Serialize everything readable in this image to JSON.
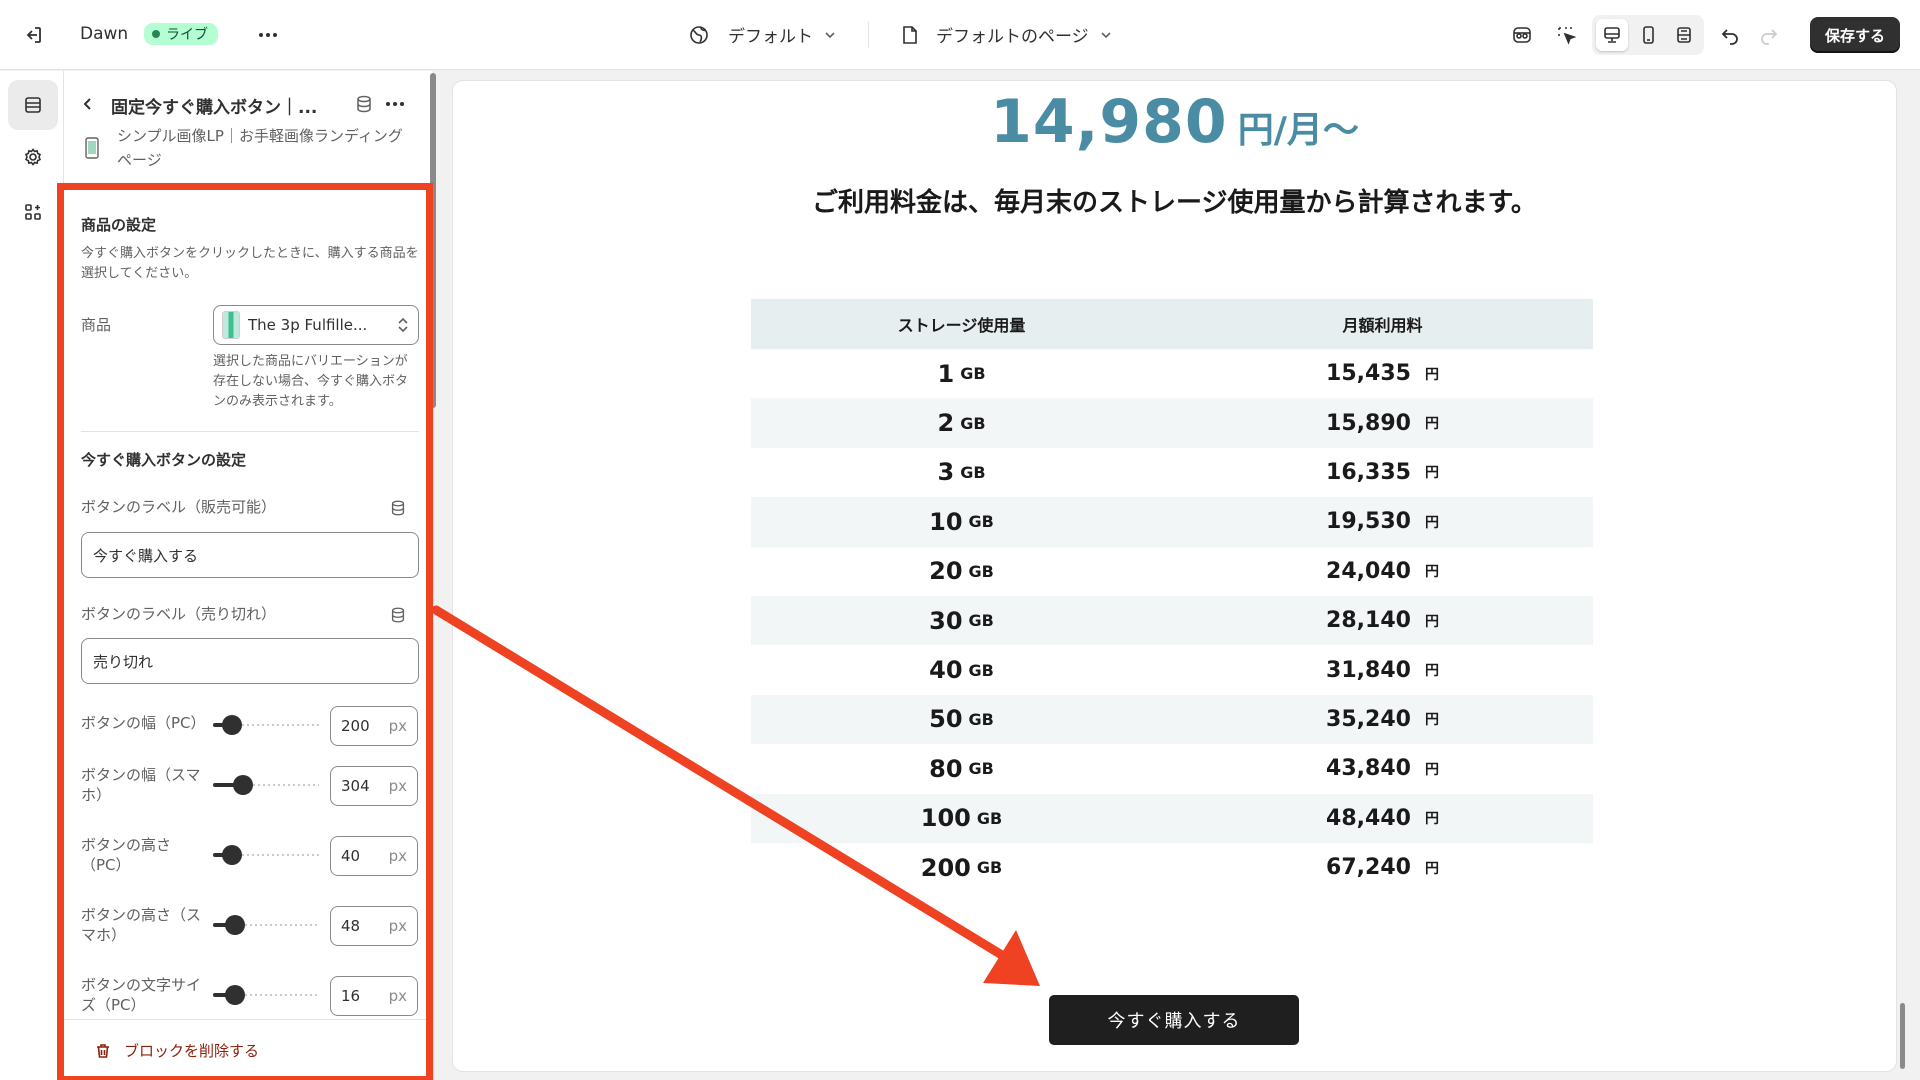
{
  "topbar": {
    "theme_name": "Dawn",
    "live_badge": "ライブ",
    "template_dropdown": "デフォルト",
    "page_dropdown": "デフォルトのページ",
    "save_label": "保存する"
  },
  "panel": {
    "block_title": "固定今すぐ購入ボタン｜...",
    "page_subtitle": "シンプル画像LP｜お手軽画像ランディングページ",
    "product_settings": {
      "title": "商品の設定",
      "help": "今すぐ購入ボタンをクリックしたときに、購入する商品を選択してください。",
      "product_label": "商品",
      "product_value": "The 3p Fulfille...",
      "variation_note": "選択した商品にバリエーションが存在しない場合、今すぐ購入ボタンのみ表示されます。"
    },
    "button_settings": {
      "title": "今すぐ購入ボタンの設定",
      "label_available": "ボタンのラベル（販売可能）",
      "value_available": "今すぐ購入する",
      "label_soldout": "ボタンのラベル（売り切れ）",
      "value_soldout": "売り切れ"
    },
    "sliders": [
      {
        "label": "ボタンの幅（PC）",
        "value": "200",
        "unit": "px",
        "fraction": 0.18
      },
      {
        "label": "ボタンの幅（スマホ）",
        "value": "304",
        "unit": "px",
        "fraction": 0.28
      },
      {
        "label": "ボタンの高さ（PC）",
        "value": "40",
        "unit": "px",
        "fraction": 0.18
      },
      {
        "label": "ボタンの高さ（スマホ）",
        "value": "48",
        "unit": "px",
        "fraction": 0.21
      },
      {
        "label": "ボタンの文字サイズ（PC）",
        "value": "16",
        "unit": "px",
        "fraction": 0.21
      }
    ],
    "delete_label": "ブロックを削除する"
  },
  "preview": {
    "price_number": "14,980",
    "price_unit": "円/月〜",
    "pricing_note": "ご利用料金は、毎月末のストレージ使用量から計算されます。",
    "table": {
      "headers": [
        "ストレージ使用量",
        "月額利用料"
      ],
      "rows": [
        {
          "storage": "1",
          "storage_unit": "GB",
          "fee": "15,435",
          "fee_unit": "円"
        },
        {
          "storage": "2",
          "storage_unit": "GB",
          "fee": "15,890",
          "fee_unit": "円"
        },
        {
          "storage": "3",
          "storage_unit": "GB",
          "fee": "16,335",
          "fee_unit": "円"
        },
        {
          "storage": "10",
          "storage_unit": "GB",
          "fee": "19,530",
          "fee_unit": "円"
        },
        {
          "storage": "20",
          "storage_unit": "GB",
          "fee": "24,040",
          "fee_unit": "円"
        },
        {
          "storage": "30",
          "storage_unit": "GB",
          "fee": "28,140",
          "fee_unit": "円"
        },
        {
          "storage": "40",
          "storage_unit": "GB",
          "fee": "31,840",
          "fee_unit": "円"
        },
        {
          "storage": "50",
          "storage_unit": "GB",
          "fee": "35,240",
          "fee_unit": "円"
        },
        {
          "storage": "80",
          "storage_unit": "GB",
          "fee": "43,840",
          "fee_unit": "円"
        },
        {
          "storage": "100",
          "storage_unit": "GB",
          "fee": "48,440",
          "fee_unit": "円"
        },
        {
          "storage": "200",
          "storage_unit": "GB",
          "fee": "67,240",
          "fee_unit": "円"
        }
      ]
    },
    "buy_button": "今すぐ購入する"
  },
  "colors": {
    "accent_price": "#4a8ca3",
    "annotation": "#ee4222",
    "live_badge_bg": "#b4fed2"
  },
  "icons": [
    "exit-icon",
    "more-icon",
    "globe-icon",
    "chevron-down-icon",
    "page-icon",
    "inspector-icon",
    "select-icon",
    "desktop-icon",
    "mobile-icon",
    "fullwidth-icon",
    "undo-icon",
    "redo-icon",
    "sections-icon",
    "gear-icon",
    "apps-icon",
    "back-icon",
    "database-icon",
    "phone-icon",
    "select-arrows-icon",
    "trash-icon"
  ]
}
